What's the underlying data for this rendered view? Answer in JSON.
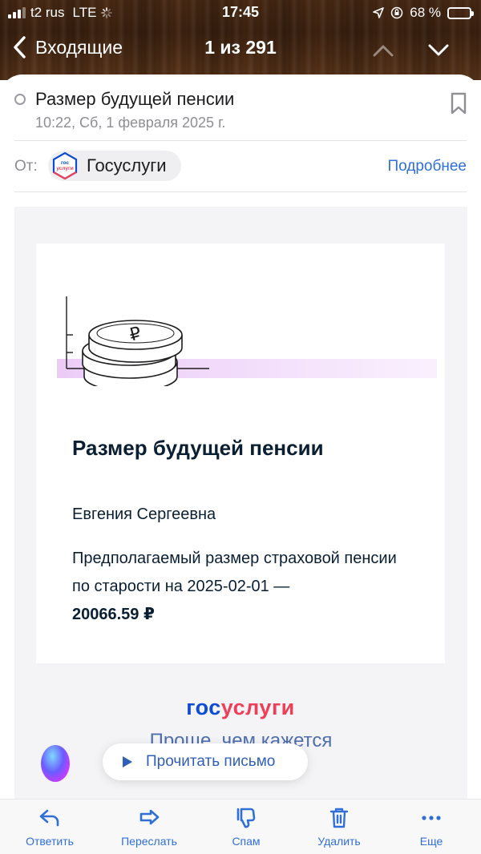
{
  "status_bar": {
    "carrier": "t2 rus",
    "network": "LTE",
    "time": "17:45",
    "battery_percent": "68 %",
    "battery_level": 0.68
  },
  "nav": {
    "back_label": "Входящие",
    "counter": "1 из 291"
  },
  "message": {
    "subject": "Размер будущей пенсии",
    "date": "10:22, Сб, 1 февраля 2025 г.",
    "from_label": "От:",
    "sender": "Госуслуги",
    "details_link": "Подробнее"
  },
  "email_body": {
    "title": "Размер будущей пенсии",
    "recipient_name": "Евгения Сергеевна",
    "text_before": "Предполагаемый размер страховой пенсии по старости на 2025-02-01 —",
    "amount": "20066.59 ₽",
    "brand_gos": "гос",
    "brand_uslugi": "услуги",
    "slogan": "Проще, чем кажется"
  },
  "read_aloud": {
    "label": "Прочитать письмо"
  },
  "toolbar": {
    "reply": "Ответить",
    "forward": "Переслать",
    "spam": "Спам",
    "delete": "Удалить",
    "more": "Еще"
  },
  "icons": {
    "back": "chevron-left-icon",
    "up": "chevron-up-icon",
    "down": "chevron-down-icon",
    "bookmark": "bookmark-icon",
    "play": "play-icon"
  },
  "colors": {
    "accent": "#2f6fd6",
    "brand_blue": "#0d4cd3",
    "brand_red": "#ee3f58",
    "text_dark": "#0b1f33"
  }
}
